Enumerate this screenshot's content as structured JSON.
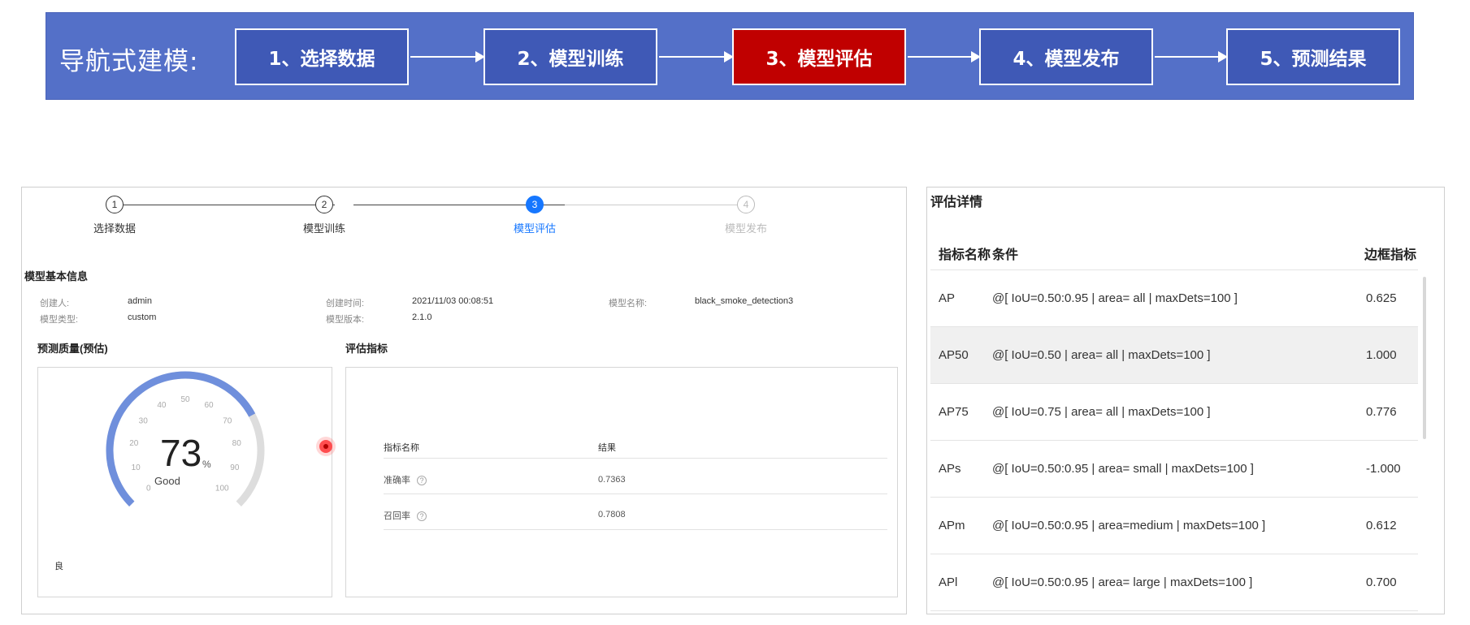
{
  "banner": {
    "title": "导航式建模:",
    "steps": [
      {
        "label": "1、选择数据"
      },
      {
        "label": "2、模型训练"
      },
      {
        "label": "3、模型评估"
      },
      {
        "label": "4、模型发布"
      },
      {
        "label": "5、预测结果"
      }
    ],
    "active_color": "#c00000",
    "bg_color": "#5470c8"
  },
  "progress": {
    "steps": [
      {
        "num": "1",
        "label": "选择数据",
        "state": "done"
      },
      {
        "num": "2",
        "label": "模型训练",
        "state": "done"
      },
      {
        "num": "3",
        "label": "模型评估",
        "state": "current"
      },
      {
        "num": "4",
        "label": "模型发布",
        "state": "future"
      }
    ]
  },
  "basic_info": {
    "title": "模型基本信息",
    "creator_label": "创建人:",
    "creator": "admin",
    "created_label": "创建时间:",
    "created": "2021/11/03 00:08:51",
    "name_label": "模型名称:",
    "name": "black_smoke_detection3",
    "type_label": "模型类型:",
    "type": "custom",
    "version_label": "模型版本:",
    "version": "2.1.0"
  },
  "quality": {
    "title": "预测质量(预估)",
    "value": "73",
    "unit": "%",
    "rating": "Good",
    "grade": "良",
    "percent": 73,
    "ticks": [
      "0",
      "10",
      "20",
      "30",
      "40",
      "50",
      "60",
      "70",
      "80",
      "90",
      "100"
    ],
    "accent": "#6f8fdc"
  },
  "metrics": {
    "title": "评估指标",
    "col_name": "指标名称",
    "col_result": "结果",
    "rows": [
      {
        "name": "准确率",
        "value": "0.7363"
      },
      {
        "name": "召回率",
        "value": "0.7808"
      }
    ]
  },
  "detail": {
    "title": "评估详情",
    "col_metric": "指标名称",
    "col_condition": "条件",
    "col_bbox": "边框指标",
    "rows": [
      {
        "metric": "AP",
        "condition": "@[ IoU=0.50:0.95 | area= all | maxDets=100 ]",
        "value": "0.625"
      },
      {
        "metric": "AP50",
        "condition": "@[ IoU=0.50 | area= all | maxDets=100 ]",
        "value": "1.000"
      },
      {
        "metric": "AP75",
        "condition": "@[ IoU=0.75 | area= all | maxDets=100 ]",
        "value": "0.776"
      },
      {
        "metric": "APs",
        "condition": "@[ IoU=0.50:0.95 | area= small | maxDets=100 ]",
        "value": "-1.000"
      },
      {
        "metric": "APm",
        "condition": "@[ IoU=0.50:0.95 | area=medium | maxDets=100 ]",
        "value": "0.612"
      },
      {
        "metric": "APl",
        "condition": "@[ IoU=0.50:0.95 | area= large | maxDets=100 ]",
        "value": "0.700"
      }
    ]
  }
}
